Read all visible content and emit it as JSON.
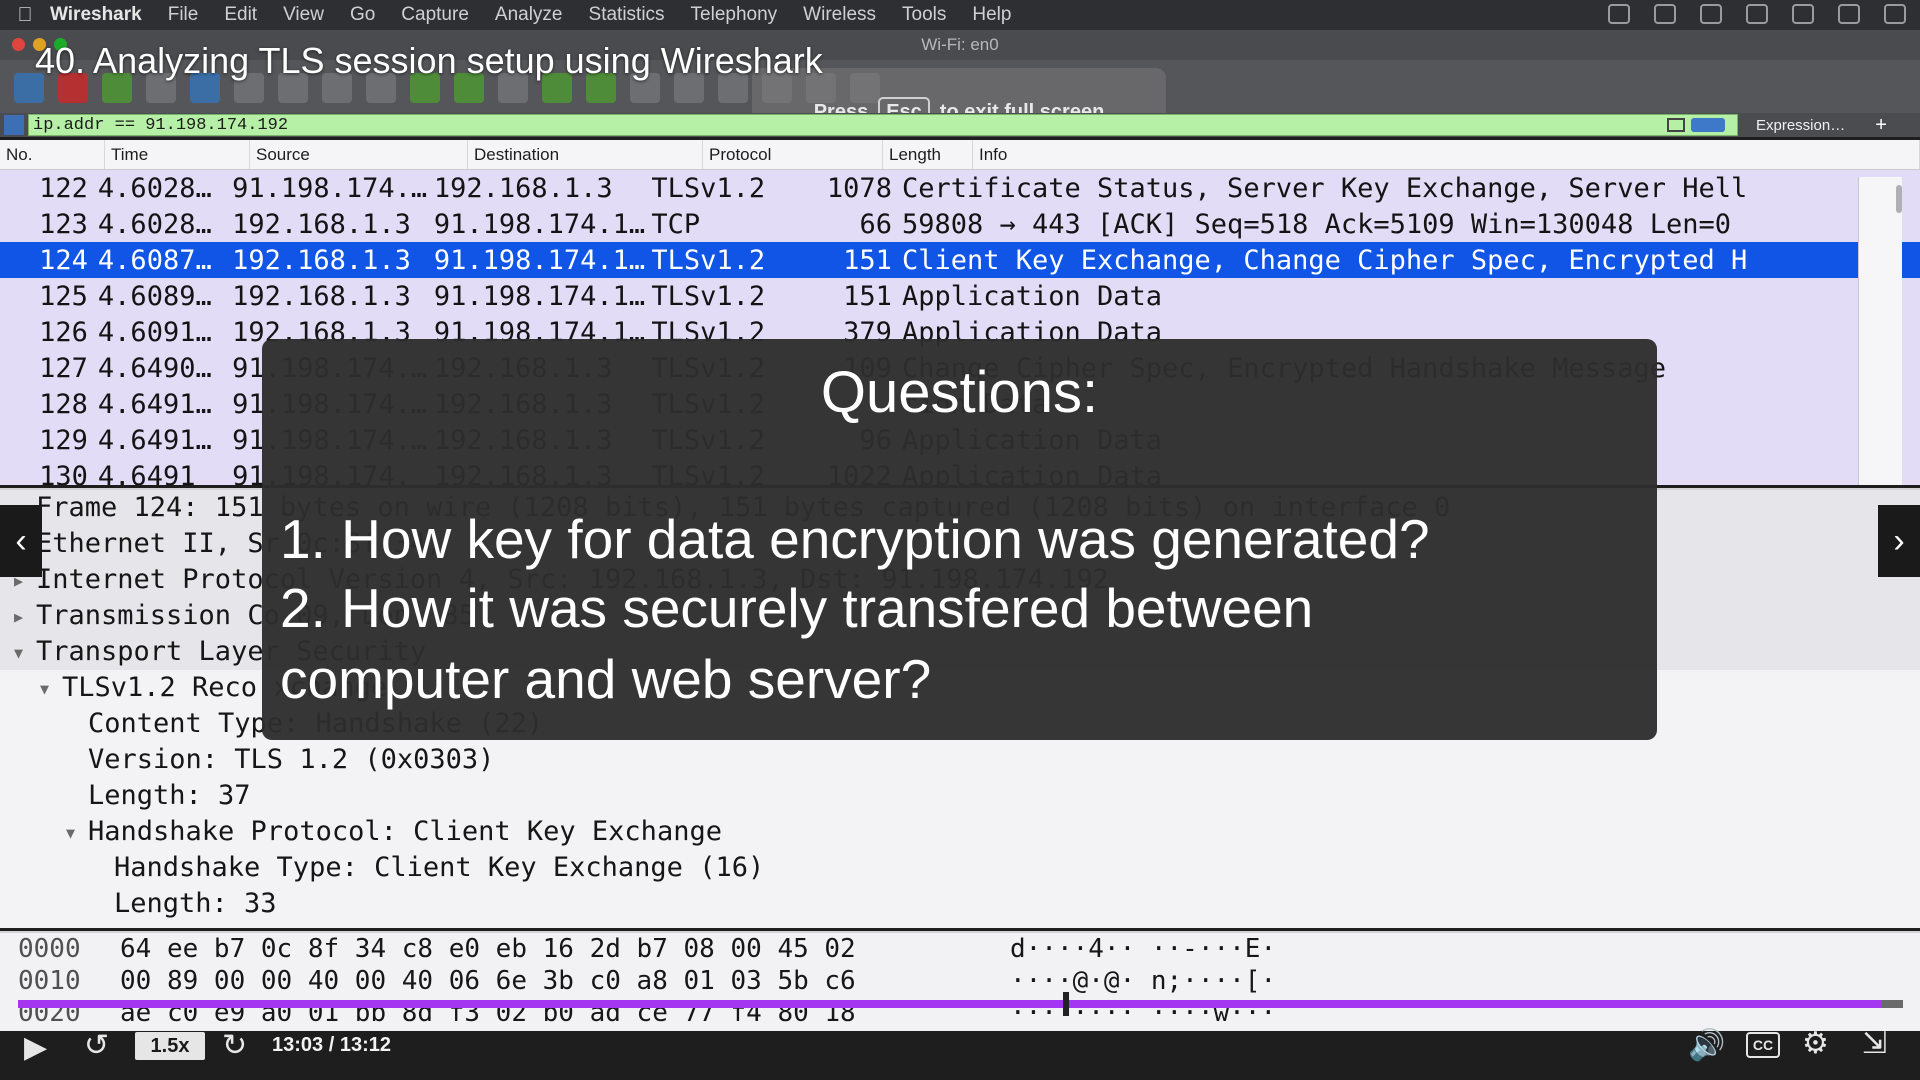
{
  "menubar": {
    "app": "Wireshark",
    "items": [
      "File",
      "Edit",
      "View",
      "Go",
      "Capture",
      "Analyze",
      "Statistics",
      "Telephony",
      "Wireless",
      "Tools",
      "Help"
    ]
  },
  "window": {
    "title": "Wi-Fi: en0"
  },
  "fullscreen_hint": {
    "press": "Press",
    "key": "Esc",
    "rest": "to exit full screen"
  },
  "filter": {
    "value": "ip.addr == 91.198.174.192",
    "expression_label": "Expression…",
    "add_label": "+"
  },
  "course": {
    "title": "40. Analyzing TLS session setup using Wireshark"
  },
  "packet_list": {
    "columns": [
      "No.",
      "Time",
      "Source",
      "Destination",
      "Protocol",
      "Length",
      "Info"
    ],
    "rows": [
      {
        "no": "122",
        "time": "4.6028…",
        "src": "91.198.174.…",
        "dst": "192.168.1.3",
        "proto": "TLSv1.2",
        "len": "1078",
        "info": "Certificate Status, Server Key Exchange, Server Hell"
      },
      {
        "no": "123",
        "time": "4.6028…",
        "src": "192.168.1.3",
        "dst": "91.198.174.1…",
        "proto": "TCP",
        "len": "66",
        "info": "59808 → 443 [ACK] Seq=518 Ack=5109 Win=130048 Len=0"
      },
      {
        "no": "124",
        "time": "4.6087…",
        "src": "192.168.1.3",
        "dst": "91.198.174.1…",
        "proto": "TLSv1.2",
        "len": "151",
        "info": "Client Key Exchange, Change Cipher Spec, Encrypted H"
      },
      {
        "no": "125",
        "time": "4.6089…",
        "src": "192.168.1.3",
        "dst": "91.198.174.1…",
        "proto": "TLSv1.2",
        "len": "151",
        "info": "Application Data"
      },
      {
        "no": "126",
        "time": "4.6091…",
        "src": "192.168.1.3",
        "dst": "91.198.174.1…",
        "proto": "TLSv1.2",
        "len": "379",
        "info": "Application Data"
      },
      {
        "no": "127",
        "time": "4.6490…",
        "src": "91.198.174.…",
        "dst": "192.168.1.3",
        "proto": "TLSv1.2",
        "len": "109",
        "info": "Change Cipher Spec, Encrypted Handshake Message"
      },
      {
        "no": "128",
        "time": "4.6491…",
        "src": "91.198.174.…",
        "dst": "192.168.1.3",
        "proto": "TLSv1.2",
        "len": "",
        "info": "tion Data"
      },
      {
        "no": "129",
        "time": "4.6491…",
        "src": "91.198.174.…",
        "dst": "192.168.1.3",
        "proto": "TLSv1.2",
        "len": "96",
        "info": "Application Data"
      },
      {
        "no": "130",
        "time": "4.6491",
        "src": "91.198.174.",
        "dst": "192.168.1.3",
        "proto": "TLSv1.2",
        "len": "1022",
        "info": "Application Data"
      }
    ]
  },
  "details": {
    "rows": [
      {
        "text": "Frame 124: 151 bytes on wire (1208 bits), 151 bytes captured (1208 bits) on interface 0",
        "tri": "",
        "shaded": true
      },
      {
        "text": "Ethernet II, Sr                                                         0c:8f:34)",
        "tri": "",
        "shaded": true
      },
      {
        "text": "Internet Protocol Version 4, Src: 192.168.1.3, Dst: 91.198.174.192",
        "tri": "▶",
        "shaded": true
      },
      {
        "text": "Transmission Co                                                    09, Len: 85",
        "tri": "▶",
        "shaded": true
      },
      {
        "text": "Transport Layer Security",
        "tri": "▼",
        "shaded": true
      },
      {
        "text": "TLSv1.2 Reco                                               xchange",
        "tri": "▼",
        "shaded": false
      },
      {
        "text": "Content Type: Handshake (22)",
        "tri": "",
        "shaded": false
      },
      {
        "text": "Version: TLS 1.2 (0x0303)",
        "tri": "",
        "shaded": false
      },
      {
        "text": "Length: 37",
        "tri": "",
        "shaded": false
      },
      {
        "text": "Handshake Protocol: Client Key Exchange",
        "tri": "▼",
        "shaded": false
      },
      {
        "text": "Handshake Type: Client Key Exchange (16)",
        "tri": "",
        "shaded": false
      },
      {
        "text": "Length: 33",
        "tri": "",
        "shaded": false
      }
    ]
  },
  "bytes": {
    "rows": [
      {
        "off": "0000",
        "hex": "64 ee b7 0c 8f 34 c8 e0  eb 16 2d b7 08 00 45 02",
        "ascii": "d····4·· ··-···E·"
      },
      {
        "off": "0010",
        "hex": "00 89 00 00 40 00 40 06  6e 3b c0 a8 01 03 5b c6",
        "ascii": "····@·@· n;····[·"
      },
      {
        "off": "0020",
        "hex": "ae c0 e9 a0 01 bb 8d f3  02 b0 ad ce 77 f4 80 18",
        "ascii": "········ ····w···"
      }
    ]
  },
  "overlay": {
    "title": "Questions:",
    "q1": "1. How key for data encryption was generated?",
    "q2": "2. How it was securely transfered between",
    "q3": "computer and web server?"
  },
  "player": {
    "speed": "1.5x",
    "time": "13:03 / 13:12",
    "progress_fraction": 0.9886,
    "cc_label": "CC",
    "accent": "#a435f0"
  }
}
